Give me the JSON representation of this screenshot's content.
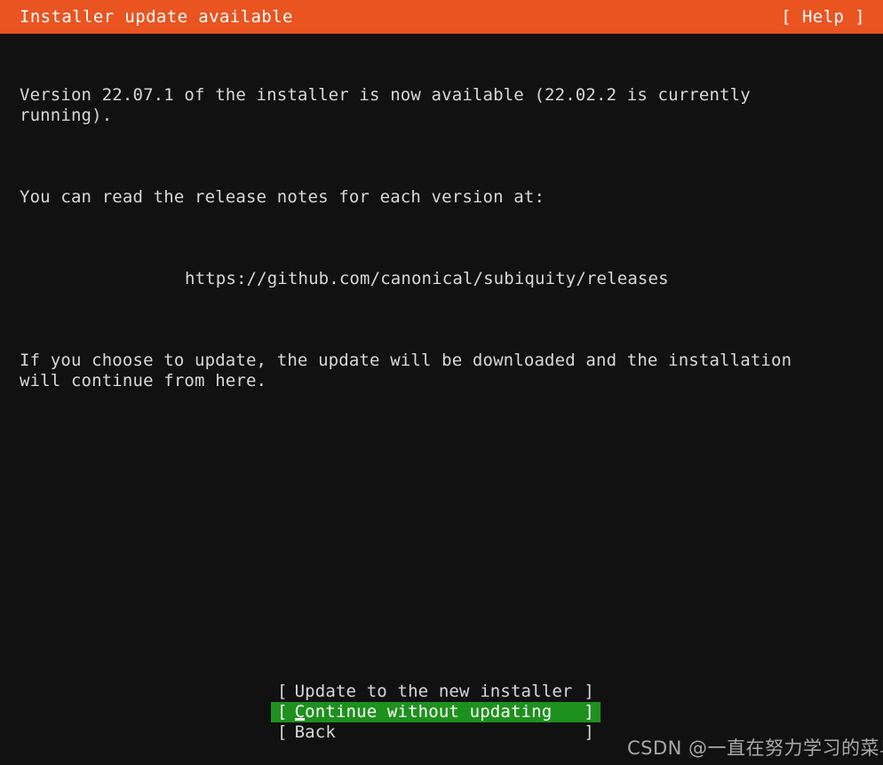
{
  "colors": {
    "header_background": "#e95420",
    "screen_background": "#111111",
    "text": "#d8d8d8",
    "selection_background": "#1e901e",
    "selection_text": "#ffffff",
    "watermark_text": "#a9a9a9"
  },
  "header": {
    "title": "Installer update available",
    "help_label": "[ Help ]"
  },
  "body": {
    "paragraphs": [
      "Version 22.07.1 of the installer is now available (22.02.2 is currently\nrunning).",
      "You can read the release notes for each version at:",
      "https://github.com/canonical/subiquity/releases",
      "If you choose to update, the update will be downloaded and the installation\nwill continue from here."
    ],
    "available_version": "22.07.1",
    "running_version": "22.02.2",
    "release_notes_url": "https://github.com/canonical/subiquity/releases"
  },
  "buttons": [
    {
      "label": "Update to the new installer",
      "bracket_left": "[",
      "bracket_right": "]",
      "selected": false
    },
    {
      "label": "Continue without updating",
      "bracket_left": "[",
      "bracket_right": "]",
      "selected": true
    },
    {
      "label": "Back",
      "bracket_left": "[",
      "bracket_right": "]",
      "selected": false
    }
  ],
  "watermark": {
    "text": "CSDN @一直在努力学习的菜鸟"
  }
}
